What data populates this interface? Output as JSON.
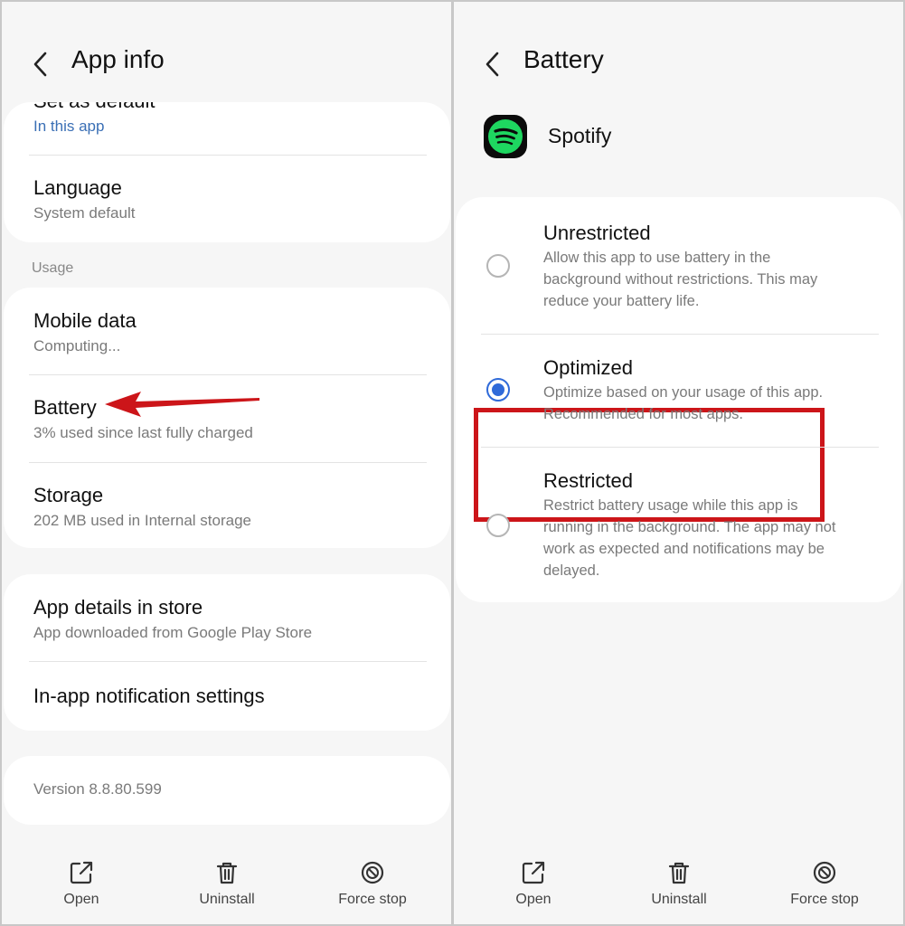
{
  "colors": {
    "accent": "#2f6ad9",
    "link": "#3a6fb5",
    "highlight": "#cc1519",
    "spotify_green": "#1ed760"
  },
  "left": {
    "header": {
      "title": "App info",
      "back_icon": "chevron-left-icon"
    },
    "default_card": {
      "partial_title": "Set as default",
      "sub": "In this app"
    },
    "language": {
      "title": "Language",
      "sub": "System default"
    },
    "usage_label": "Usage",
    "usage_items": [
      {
        "title": "Mobile data",
        "sub": "Computing..."
      },
      {
        "title": "Battery",
        "sub": "3% used since last fully charged"
      },
      {
        "title": "Storage",
        "sub": "202 MB used in Internal storage"
      }
    ],
    "store_items": [
      {
        "title": "App details in store",
        "sub": "App downloaded from Google Play Store"
      },
      {
        "title": "In-app notification settings"
      }
    ],
    "version": "Version 8.8.80.599",
    "bottom_bar": [
      {
        "label": "Open",
        "icon": "open-external-icon"
      },
      {
        "label": "Uninstall",
        "icon": "trash-icon"
      },
      {
        "label": "Force stop",
        "icon": "force-stop-icon"
      }
    ]
  },
  "right": {
    "header": {
      "title": "Battery",
      "back_icon": "chevron-left-icon"
    },
    "app": {
      "name": "Spotify",
      "icon": "spotify-icon"
    },
    "options": [
      {
        "title": "Unrestricted",
        "sub": "Allow this app to use battery in the background without restrictions. This may reduce your battery life.",
        "selected": false
      },
      {
        "title": "Optimized",
        "sub": "Optimize based on your usage of this app. Recommended for most apps.",
        "selected": true
      },
      {
        "title": "Restricted",
        "sub": "Restrict battery usage while this app is running in the background. The app may not work as expected and notifications may be delayed.",
        "selected": false
      }
    ],
    "bottom_bar": [
      {
        "label": "Open",
        "icon": "open-external-icon"
      },
      {
        "label": "Uninstall",
        "icon": "trash-icon"
      },
      {
        "label": "Force stop",
        "icon": "force-stop-icon"
      }
    ]
  }
}
